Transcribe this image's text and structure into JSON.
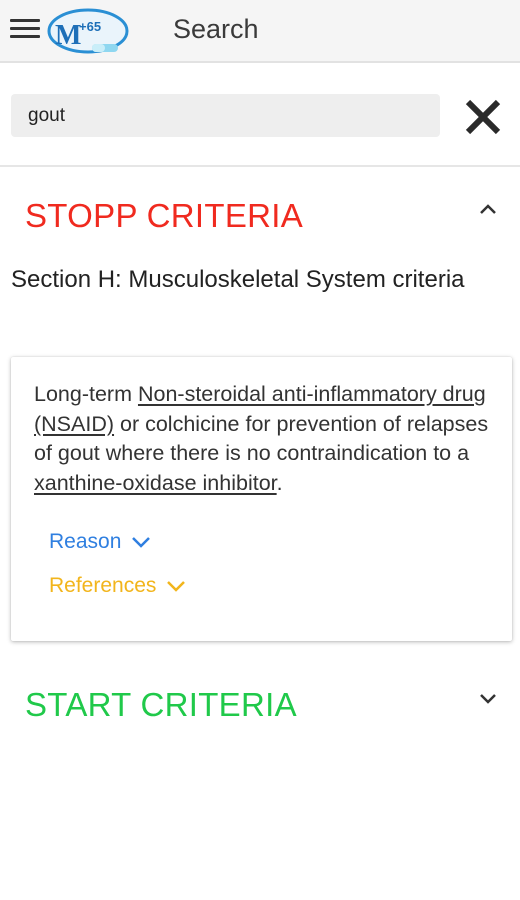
{
  "appbar": {
    "title": "Search",
    "logo_text": "M",
    "logo_superscript": "+65"
  },
  "search": {
    "value": "gout",
    "placeholder": ""
  },
  "stopp": {
    "title": "STOPP CRITERIA",
    "section": "Section H: Musculoskeletal System criteria",
    "card": {
      "text_1": "Long-term ",
      "link_nsaid": "Non-steroidal anti-inflammatory drug (NSAID)",
      "text_2": " or colchicine for prevention of relapses of gout where there is no contraindication to a ",
      "link_xanthine": "xanthine-oxidase inhibitor",
      "text_3": ".",
      "reason_label": "Reason",
      "references_label": "References"
    }
  },
  "start": {
    "title": "START CRITERIA"
  },
  "colors": {
    "stopp": "#f02a1f",
    "start": "#20c94a",
    "reason": "#2f7fe0",
    "references": "#f2b51c"
  },
  "icons": {
    "menu": "hamburger-menu-icon",
    "close": "close-x-icon",
    "stopp_toggle": "chevron-up-icon",
    "start_toggle": "chevron-down-icon"
  }
}
